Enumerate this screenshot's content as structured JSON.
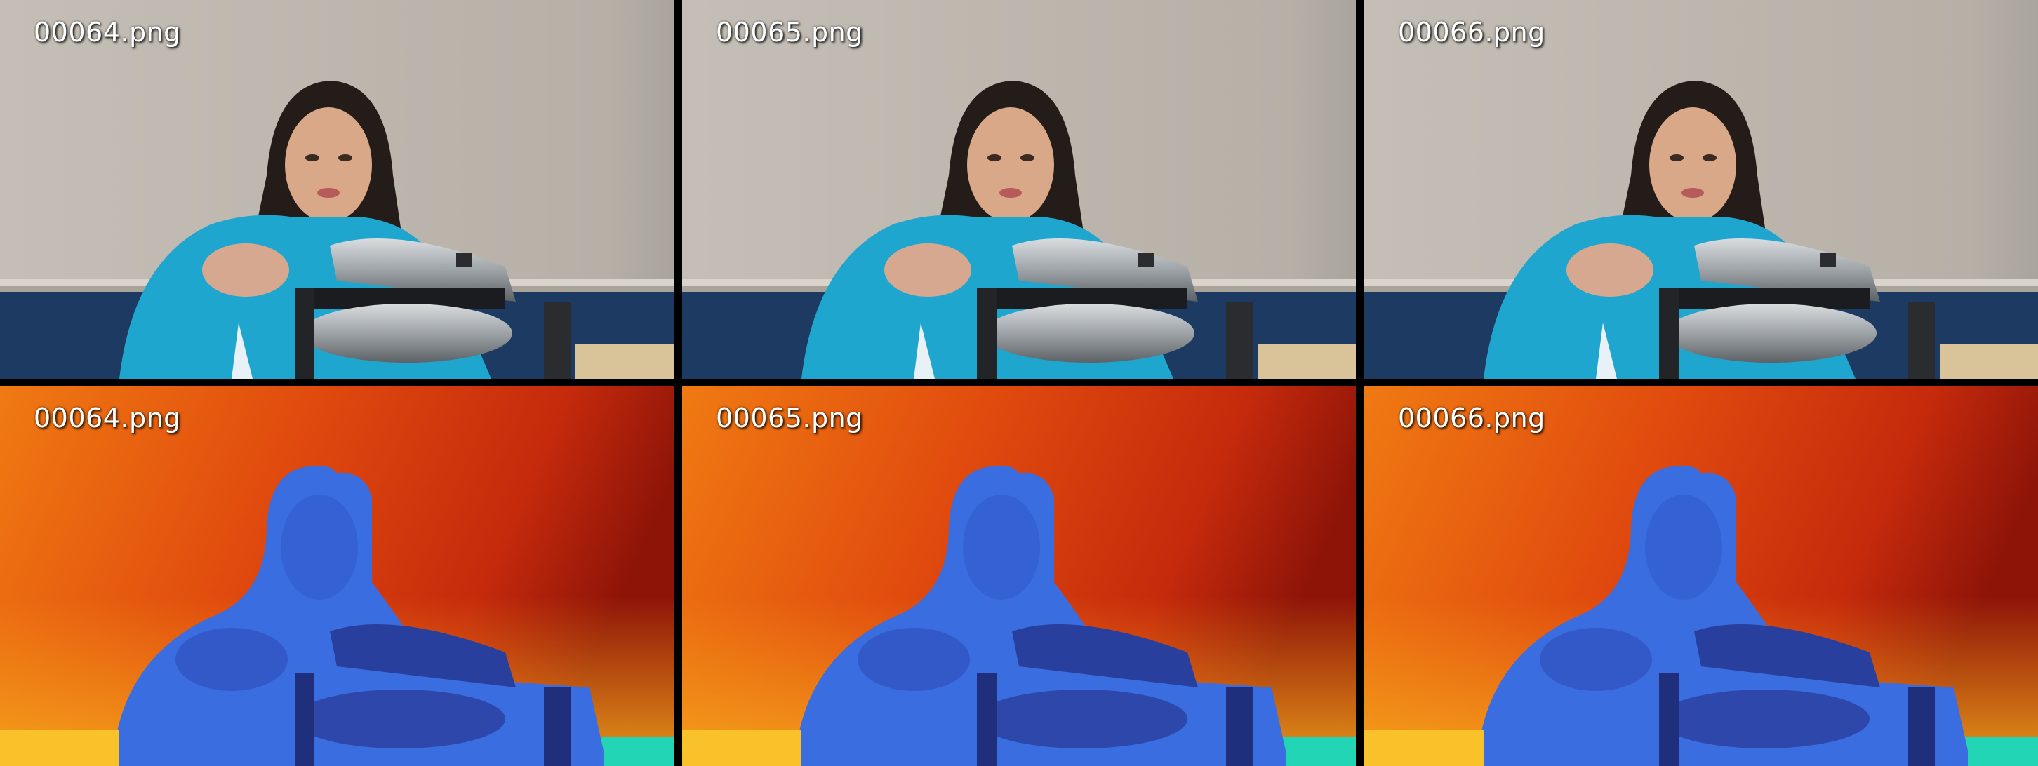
{
  "frames": [
    {
      "label": "00064.png",
      "kind": "rgb"
    },
    {
      "label": "00065.png",
      "kind": "rgb"
    },
    {
      "label": "00066.png",
      "kind": "rgb"
    }
  ],
  "depth_frames": [
    {
      "label": "00064.png",
      "kind": "depth"
    },
    {
      "label": "00065.png",
      "kind": "depth"
    },
    {
      "label": "00066.png",
      "kind": "depth"
    }
  ],
  "colors": {
    "wall": "#b9b3aa",
    "wainscot": "#1d3a63",
    "hoodie": "#1fa6cf",
    "hair": "#241c18",
    "skin": "#d8a888",
    "steel": "#a9aeb3",
    "depth_far": "#b31c0c",
    "depth_mid": "#e8520f",
    "depth_near_bg": "#f7a51a",
    "depth_person": "#3a6de0",
    "depth_appliance": "#283f9e",
    "depth_table": "#22d6b5"
  }
}
